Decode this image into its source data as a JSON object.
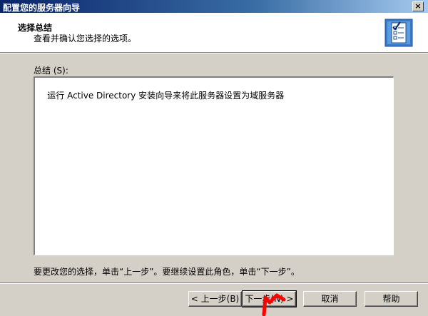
{
  "window": {
    "title": "配置您的服务器向导",
    "close_glyph": "×"
  },
  "header": {
    "title": "选择总结",
    "subtitle": "查看并确认您选择的选项。",
    "icon": "wizard-checklist-icon"
  },
  "summary": {
    "label": "总结",
    "label_mnemonic": "(S):",
    "content": "运行 Active Directory 安装向导来将此服务器设置为域服务器"
  },
  "instruction": "要更改您的选择，单击“上一步”。要继续设置此角色，单击“下一步”。",
  "buttons": {
    "back": "< 上一步(B)",
    "next": "下一步(N) >",
    "cancel": "取消",
    "help": "帮助"
  },
  "colors": {
    "titlebar_start": "#0a246a",
    "titlebar_end": "#a6caf0",
    "dialog_bg": "#d4d0c8",
    "cursor": "#ff0000"
  }
}
